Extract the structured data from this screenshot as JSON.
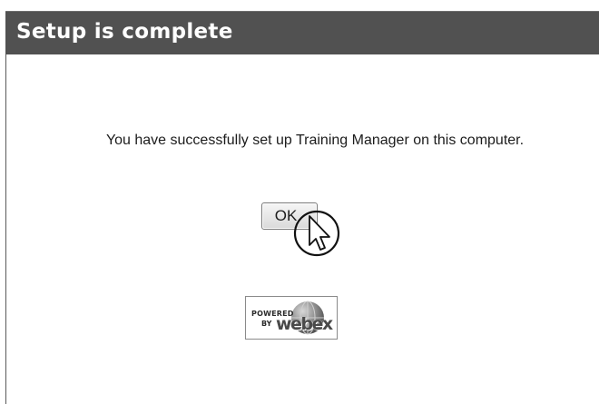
{
  "dialog": {
    "title": "Setup is complete",
    "message": "You have successfully set up Training Manager on this computer.",
    "ok_label": "OK"
  },
  "badge": {
    "powered": "POWERED",
    "by": "BY",
    "brand": "webex"
  },
  "colors": {
    "titlebar": "#515151",
    "title_text": "#ffffff",
    "body_text": "#1c1c1c"
  },
  "icons": {
    "cursor": "mouse-pointer-icon",
    "globe": "globe-icon"
  }
}
